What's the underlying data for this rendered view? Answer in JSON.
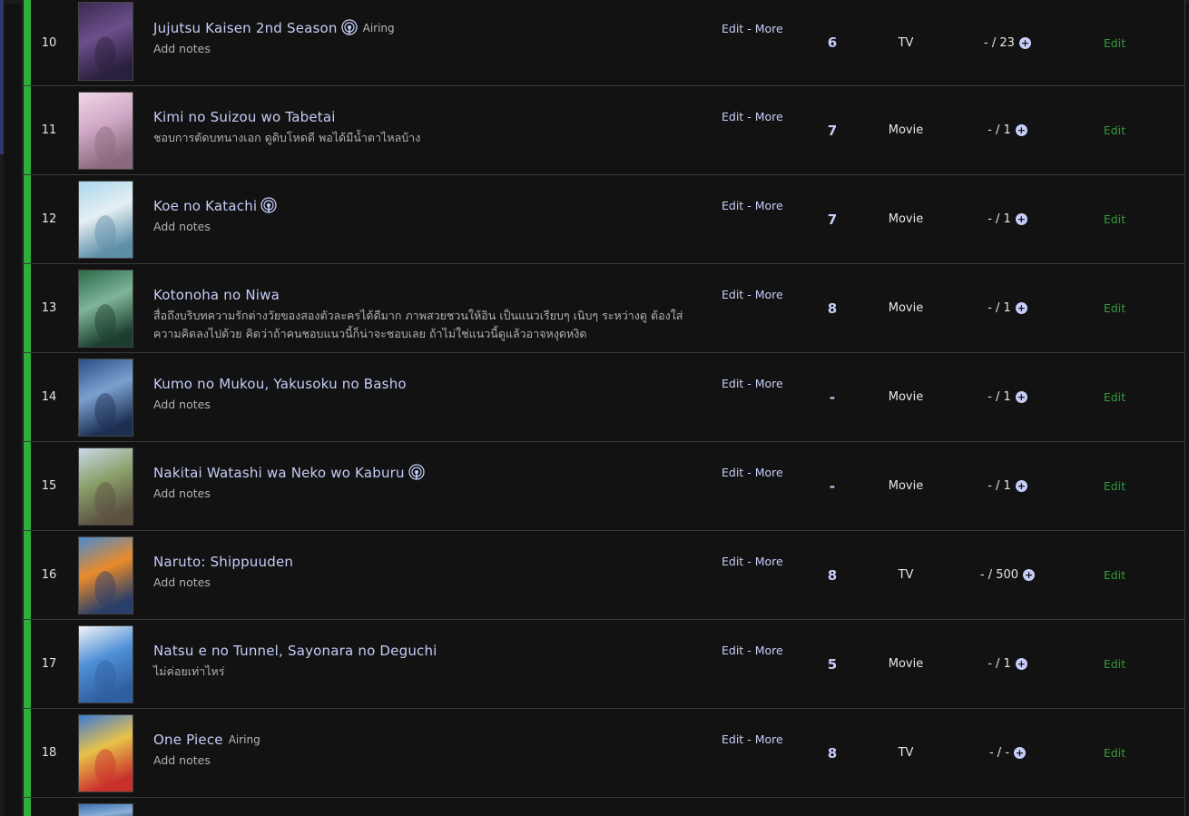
{
  "colors": {
    "status_bar": "#2db039",
    "link": "#c5cdf8",
    "edit": "#2e9e35",
    "background": "#121212"
  },
  "links": {
    "edit_label": "Edit",
    "more_label": "More",
    "separator": " - "
  },
  "row_edit_label": "Edit",
  "rows": [
    {
      "num": "10",
      "title": "Jujutsu Kaisen 2nd Season",
      "airing_icon": true,
      "airing_text": "Airing",
      "notes": "Add notes",
      "score": "6",
      "type": "TV",
      "progress": "- / 23",
      "thumb": [
        "#3b2a52",
        "#6b4f8a",
        "#2a1f3c"
      ]
    },
    {
      "num": "11",
      "title": "Kimi no Suizou wo Tabetai",
      "airing_icon": false,
      "airing_text": "",
      "notes": "ชอบการตัดบทนางเอก ดูดิบโหดดี พอได้มีน้ำตาไหลบ้าง",
      "score": "7",
      "type": "Movie",
      "progress": "- / 1",
      "thumb": [
        "#f1d7e4",
        "#cfa8c6",
        "#8a6a7c"
      ]
    },
    {
      "num": "12",
      "title": "Koe no Katachi",
      "airing_icon": true,
      "airing_text": "",
      "notes": "Add notes",
      "score": "7",
      "type": "Movie",
      "progress": "- / 1",
      "thumb": [
        "#a9d7ee",
        "#e6eef2",
        "#5d8fa8"
      ]
    },
    {
      "num": "13",
      "title": "Kotonoha no Niwa",
      "airing_icon": false,
      "airing_text": "",
      "notes": "สื่อถึงบริบทความรักต่างวัยของสองตัวละครได้ดีมาก ภาพสวยชวนให้อิน เป็นแนวเรียบๆ เนิบๆ ระหว่างดู ต้องใส่ความคิดลงไปด้วย คิดว่าถ้าคนชอบแนวนี้ก็น่าจะชอบเลย ถ้าไม่ใช่แนวนี้ดูแล้วอาจหงุดหงิด",
      "score": "8",
      "type": "Movie",
      "progress": "- / 1",
      "thumb": [
        "#2f6a4a",
        "#7fb59a",
        "#1c3e2d"
      ]
    },
    {
      "num": "14",
      "title": "Kumo no Mukou, Yakusoku no Basho",
      "airing_icon": false,
      "airing_text": "",
      "notes": "Add notes",
      "score": "-",
      "type": "Movie",
      "progress": "- / 1",
      "thumb": [
        "#2c4f86",
        "#7aa0cf",
        "#1c2e52"
      ]
    },
    {
      "num": "15",
      "title": "Nakitai Watashi wa Neko wo Kaburu",
      "airing_icon": true,
      "airing_text": "",
      "notes": "Add notes",
      "score": "-",
      "type": "Movie",
      "progress": "- / 1",
      "thumb": [
        "#c9d8e6",
        "#8aa06a",
        "#5c5040"
      ]
    },
    {
      "num": "16",
      "title": "Naruto: Shippuuden",
      "airing_icon": false,
      "airing_text": "",
      "notes": "Add notes",
      "score": "8",
      "type": "TV",
      "progress": "- / 500",
      "thumb": [
        "#4a8ad0",
        "#e98b2a",
        "#2a3e6a"
      ]
    },
    {
      "num": "17",
      "title": "Natsu e no Tunnel, Sayonara no Deguchi",
      "airing_icon": false,
      "airing_text": "",
      "notes": "ไม่ค่อยเท่าไหร่",
      "score": "5",
      "type": "Movie",
      "progress": "- / 1",
      "thumb": [
        "#f3f5f7",
        "#4e8fd6",
        "#2f5f9e"
      ]
    },
    {
      "num": "18",
      "title": "One Piece",
      "airing_icon": false,
      "airing_text": "Airing",
      "notes": "Add notes",
      "score": "8",
      "type": "TV",
      "progress": "- / -",
      "thumb": [
        "#3c79d6",
        "#e8c24a",
        "#c9302c"
      ]
    }
  ],
  "partial_row_thumb": [
    "#3c6eb0",
    "#8ab0d8",
    "#1e3a66"
  ]
}
